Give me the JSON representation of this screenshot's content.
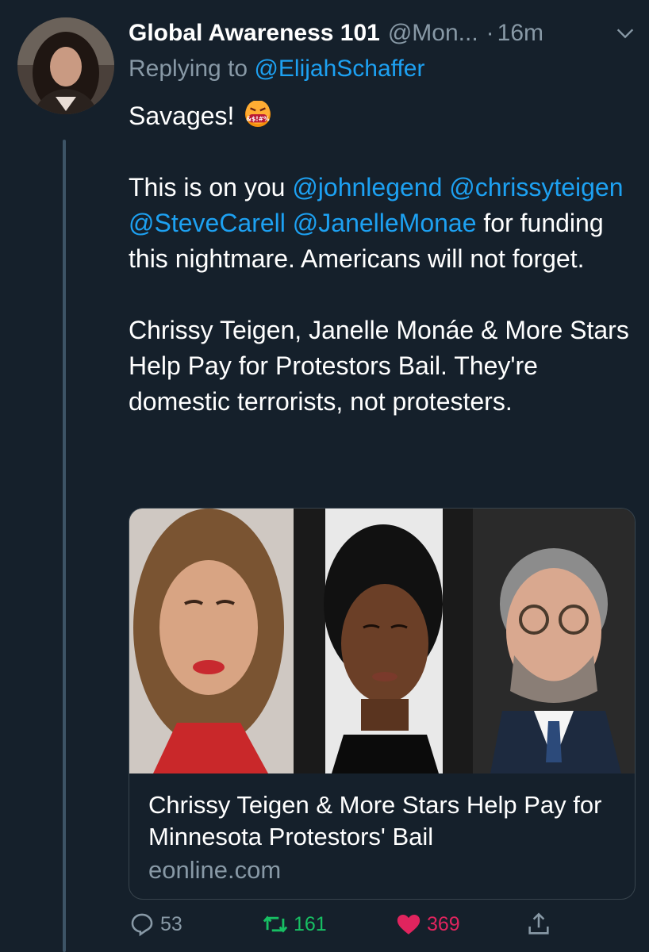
{
  "tweet": {
    "display_name": "Global Awareness 101",
    "handle": "@Mon...",
    "separator": "·",
    "time": "16m",
    "reply_prefix": "Replying to",
    "reply_to": "@ElijahSchaffer",
    "body": {
      "line1": "Savages!",
      "emoji": "face-with-symbols-on-mouth",
      "p2_text1": "This is on you",
      "mention1": "@johnlegend",
      "mention2": "@chrissyteigen",
      "mention3": "@SteveCarell",
      "mention4": "@JanelleMonae",
      "p2_text2": "for funding this nightmare. Americans will not forget.",
      "p3": "Chrissy Teigen, Janelle Monáe & More Stars Help Pay for Protestors Bail. They're domestic terrorists, not protesters."
    },
    "card": {
      "title": "Chrissy Teigen & More Stars Help Pay for Minnesota Protestors' Bail",
      "domain": "eonline.com"
    },
    "actions": {
      "replies": "53",
      "retweets": "161",
      "likes": "369"
    }
  },
  "colors": {
    "background": "#15202b",
    "link": "#1da1f2",
    "muted": "#8899a6",
    "retweet": "#17bf63",
    "like": "#e0245e"
  },
  "icons": [
    "chevron-down-icon",
    "reply-icon",
    "retweet-icon",
    "heart-icon",
    "share-icon",
    "angry-emoji-icon"
  ]
}
